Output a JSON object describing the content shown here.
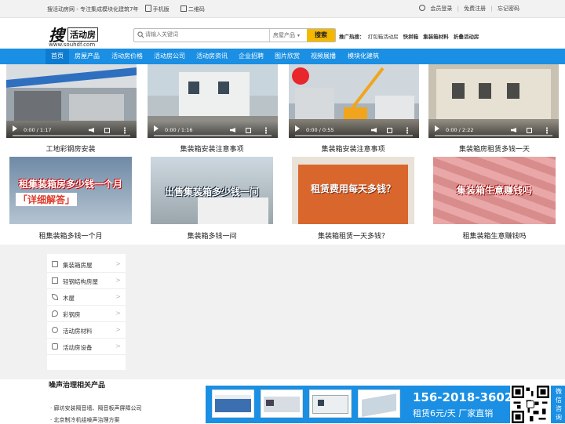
{
  "topbar": {
    "site_name": "搜活动房网 - 专注集成模块化建筑7年",
    "mobile_label": "手机版",
    "qr_label": "二维码",
    "login": "会员登录",
    "register": "免费注册",
    "forgot": "忘记密码"
  },
  "logo": {
    "big": "搜",
    "small": "活动房",
    "domain": "www.souhdf.com"
  },
  "search": {
    "placeholder": "请输入关键词",
    "category": "房屋产品",
    "button": "搜索"
  },
  "hot": {
    "label": "推广热搜：",
    "items": [
      "打包箱活动房",
      "快拼箱",
      "集装箱材料",
      "折叠活动房"
    ]
  },
  "nav": {
    "items": [
      "首页",
      "房屋产品",
      "活动房价格",
      "活动房公司",
      "活动房资讯",
      "企业招聘",
      "图片欣赏",
      "视频展播",
      "模块化建筑"
    ]
  },
  "videos": [
    {
      "time": "0:00 / 1:17",
      "title": "工地彩钢房安装",
      "progress": 0
    },
    {
      "time": "0:00 / 1:16",
      "title": "集装箱安装注意事项",
      "progress": 0
    },
    {
      "time": "0:00 / 0:55",
      "title": "集装箱安装注意事项",
      "progress": 0
    },
    {
      "time": "0:00 / 2:22",
      "title": "集装箱房租赁多钱一天",
      "progress": 0
    }
  ],
  "articles": [
    {
      "overlay": "租集装箱房多少钱一个月",
      "overlay2": "「详细解答」",
      "title": "租集装箱多钱一个月"
    },
    {
      "overlay": "出售集装箱多少钱一间",
      "title": "集装箱多钱一间"
    },
    {
      "overlay": "租赁费用每天多钱？",
      "title": "集装箱租赁一天多钱？"
    },
    {
      "overlay": "集装箱生意赚钱吗",
      "title": "租集装箱生意赚钱吗"
    }
  ],
  "sidebar": {
    "items": [
      {
        "label": "集装箱房屋",
        "icon": "house-icon"
      },
      {
        "label": "轻钢结构房屋",
        "icon": "building-icon"
      },
      {
        "label": "木屋",
        "icon": "leaf-icon"
      },
      {
        "label": "彩钢房",
        "icon": "location-icon"
      },
      {
        "label": "活动房材料",
        "icon": "gear-icon"
      },
      {
        "label": "活动房设备",
        "icon": "tool-icon"
      }
    ]
  },
  "related": {
    "title": "噪声治理相关产品",
    "items": [
      "廊坊安装隔音墙、隔音板声屏障公司",
      "北京制冷机组噪声治理方案"
    ]
  },
  "float": {
    "phone": "156-2018-3602",
    "sub": "租赁6元/天  厂家直销",
    "qr_text": "微信咨询"
  },
  "colors": {
    "nav": "#1a8fe3",
    "search_button": "#f5b800"
  }
}
